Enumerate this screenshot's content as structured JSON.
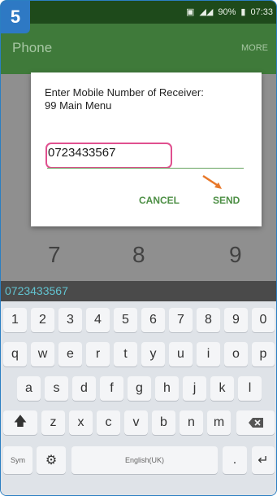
{
  "step_badge": "5",
  "status": {
    "battery_percent": "90%",
    "time": "07:33"
  },
  "app_bar": {
    "title": "Phone",
    "more": "MORE"
  },
  "dialpad_visible": [
    "7",
    "8",
    "9"
  ],
  "dialog": {
    "message_line1": "Enter Mobile Number of Receiver:",
    "message_line2": "99 Main Menu",
    "input_value": "0723433567",
    "cancel_label": "CANCEL",
    "send_label": "SEND"
  },
  "dial_display": "0723433567",
  "keyboard": {
    "row1": [
      "1",
      "2",
      "3",
      "4",
      "5",
      "6",
      "7",
      "8",
      "9",
      "0"
    ],
    "row2": [
      "q",
      "w",
      "e",
      "r",
      "t",
      "y",
      "u",
      "i",
      "o",
      "p"
    ],
    "row3": [
      "a",
      "s",
      "d",
      "f",
      "g",
      "h",
      "j",
      "k",
      "l"
    ],
    "row4": [
      "z",
      "x",
      "c",
      "v",
      "b",
      "n",
      "m"
    ],
    "sym_label": "Sym",
    "space_label": "English(UK)",
    "period_label": "."
  },
  "colors": {
    "accent_green": "#4d8f45",
    "highlight_pink": "#e0508f",
    "arrow_orange": "#e8782a",
    "badge_blue": "#2e79c4"
  }
}
